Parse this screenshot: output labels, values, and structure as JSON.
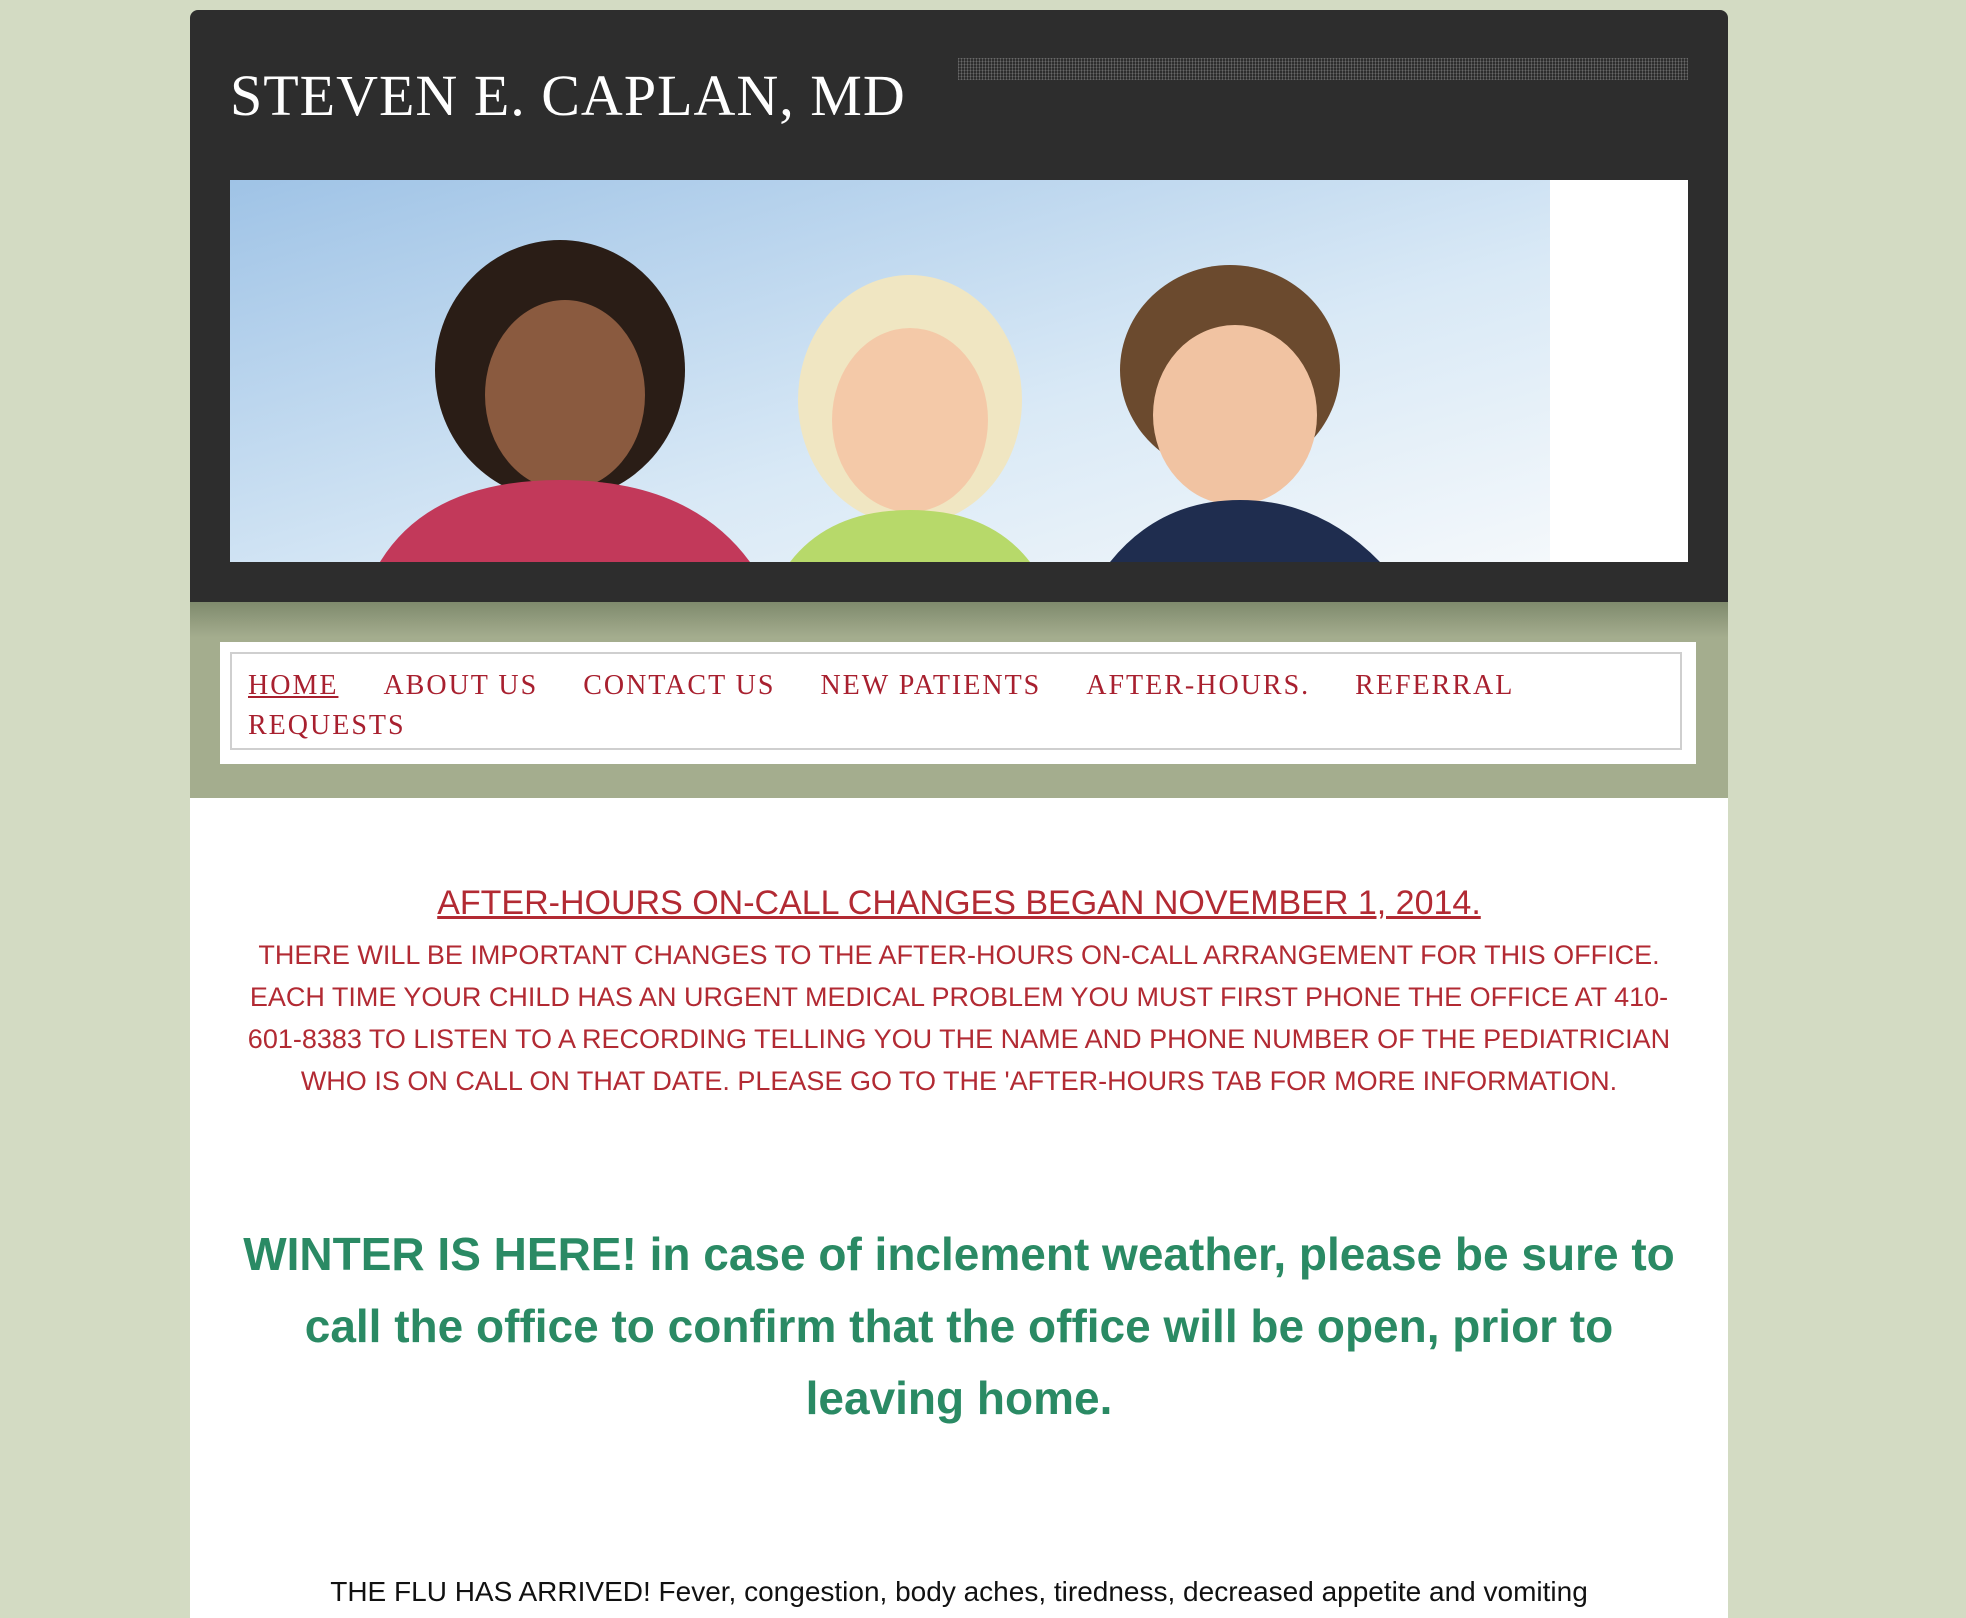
{
  "site": {
    "title": "STEVEN E. CAPLAN, MD"
  },
  "banner": {
    "description": "banner-image",
    "alt": "Three smiling children against a blue sky"
  },
  "nav": {
    "items": [
      {
        "label": "HOME",
        "active": true
      },
      {
        "label": "ABOUT US",
        "active": false
      },
      {
        "label": "CONTACT US",
        "active": false
      },
      {
        "label": "NEW PATIENTS",
        "active": false
      },
      {
        "label": "AFTER-HOURS.",
        "active": false
      },
      {
        "label": "REFERRAL REQUESTS",
        "active": false
      }
    ]
  },
  "content": {
    "notice_title": "AFTER-HOURS ON-CALL CHANGES BEGAN NOVEMBER 1, 2014.",
    "notice_body": "THERE WILL BE IMPORTANT CHANGES TO THE AFTER-HOURS ON-CALL ARRANGEMENT FOR THIS OFFICE.  EACH TIME YOUR CHILD HAS AN URGENT MEDICAL PROBLEM YOU MUST FIRST PHONE THE OFFICE AT 410-601-8383 TO LISTEN TO A RECORDING TELLING YOU THE NAME AND PHONE NUMBER OF THE PEDIATRICIAN WHO IS ON CALL ON THAT DATE. PLEASE GO TO THE 'AFTER-HOURS TAB FOR MORE INFORMATION.",
    "winter_notice": "WINTER IS HERE!  in case of inclement weather, please be sure to call the office to confirm that the office will be open, prior to leaving home.",
    "flu_notice": "THE FLU HAS ARRIVED!  Fever, congestion, body aches, tiredness, decreased appetite and vomiting"
  },
  "colors": {
    "background": "#d3dbc3",
    "header": "#2d2d2d",
    "nav_band": "#a4ad8e",
    "nav_link": "#a8202f",
    "notice": "#b22a33",
    "winter": "#2a8a64"
  }
}
